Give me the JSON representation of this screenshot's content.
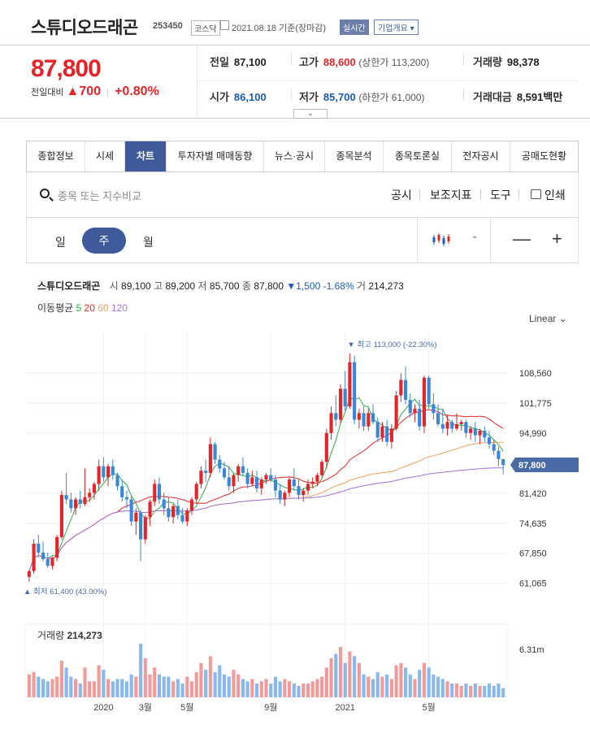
{
  "header": {
    "name": "스튜디오드래곤",
    "code": "253450",
    "market": "코스닥",
    "date": "2021.08.18 기준(장마감)",
    "realtime": "실시간",
    "company": "기업개요 ▾"
  },
  "quote": {
    "price": "87,800",
    "change_label": "전일대비",
    "change_arrow": "▲",
    "change_value": "700",
    "change_pct": "+0.80%",
    "prev_label": "전일",
    "prev": "87,100",
    "high_label": "고가",
    "high": "88,600",
    "upper": "(상한가 113,200)",
    "vol_label": "거래량",
    "vol": "98,378",
    "open_label": "시가",
    "open": "86,100",
    "low_label": "저가",
    "low": "85,700",
    "lower": "(하한가 61,000)",
    "amt_label": "거래대금",
    "amt": "8,591",
    "amt_unit": "백만",
    "toggle": "⌄"
  },
  "tabs": [
    "종합정보",
    "시세",
    "차트",
    "투자자별 매매동향",
    "뉴스·공시",
    "종목분석",
    "종목토론실",
    "전자공시",
    "공매도현황"
  ],
  "toolbar": {
    "search_placeholder": "종목 또는 지수비교",
    "disclosure": "공시",
    "indicators": "보조지표",
    "tools": "도구",
    "print": "인쇄"
  },
  "periods": {
    "day": "일",
    "week": "주",
    "month": "월"
  },
  "zoom": {
    "out": "—",
    "in": "+"
  },
  "chart_info": {
    "name": "스튜디오드래곤",
    "o_lab": "시",
    "o": "89,100",
    "h_lab": "고",
    "h": "89,200",
    "l_lab": "저",
    "l": "85,700",
    "c_lab": "종",
    "c": "87,800",
    "chg": "▼1,500 -1.68%",
    "v_lab": "거",
    "v": "214,273",
    "ma_label": "이동평균",
    "ma": [
      "5",
      "20",
      "60",
      "120"
    ],
    "scale": "Linear ⌄",
    "vol_label": "거래량",
    "vol": "214,273",
    "vol_axis": "6.31m"
  },
  "chart_data": {
    "type": "candlestick",
    "yticks": [
      108560,
      101775,
      94990,
      81420,
      74635,
      67850,
      61065
    ],
    "ylim": [
      58800,
      117000
    ],
    "current_price": 87800,
    "current_label": "87,800",
    "max_label": "▼ 최고 113,000 (-22.30%)",
    "min_label": "▲ 최저 61,400 (43.00%)",
    "max_index": 69,
    "min_index": 0,
    "x_labels": [
      {
        "label": "2020",
        "i": 16
      },
      {
        "label": "3월",
        "i": 25
      },
      {
        "label": "5월",
        "i": 34
      },
      {
        "label": "9월",
        "i": 52
      },
      {
        "label": "2021",
        "i": 68
      },
      {
        "label": "5월",
        "i": 86
      }
    ],
    "ma_colors": [
      "#2eaa4a",
      "#e0262a",
      "#f0a058",
      "#a470e0"
    ],
    "candles": [
      [
        62500,
        64000,
        61400,
        63800,
        1.0
      ],
      [
        63800,
        71000,
        63200,
        70000,
        1.1
      ],
      [
        70000,
        72000,
        67000,
        68000,
        0.9
      ],
      [
        68000,
        70500,
        66000,
        66500,
        0.8
      ],
      [
        66500,
        68000,
        64500,
        65000,
        0.7
      ],
      [
        65000,
        67000,
        64200,
        66800,
        0.8
      ],
      [
        66800,
        72000,
        66000,
        71500,
        0.9
      ],
      [
        71500,
        82000,
        71000,
        81000,
        1.6
      ],
      [
        81000,
        86000,
        79000,
        80000,
        1.3
      ],
      [
        80000,
        81500,
        77000,
        78000,
        0.9
      ],
      [
        78000,
        80500,
        76500,
        80000,
        0.8
      ],
      [
        80000,
        82000,
        78000,
        79000,
        0.6
      ],
      [
        79000,
        87000,
        78500,
        80500,
        1.3
      ],
      [
        80500,
        82500,
        79500,
        81500,
        0.7
      ],
      [
        81500,
        84000,
        80000,
        83500,
        0.7
      ],
      [
        83500,
        89000,
        82000,
        87500,
        1.4
      ],
      [
        87500,
        89500,
        84000,
        85000,
        1.2
      ],
      [
        85000,
        88000,
        83000,
        87500,
        0.8
      ],
      [
        87500,
        89000,
        84500,
        85500,
        0.7
      ],
      [
        85500,
        86000,
        82000,
        83000,
        0.8
      ],
      [
        83000,
        84500,
        79500,
        80500,
        0.8
      ],
      [
        80500,
        82000,
        78000,
        80000,
        0.7
      ],
      [
        80000,
        81000,
        74000,
        75000,
        1.0
      ],
      [
        75000,
        78000,
        72000,
        77000,
        0.9
      ],
      [
        77000,
        77500,
        66000,
        71000,
        1.3
      ],
      [
        71000,
        76500,
        70000,
        76000,
        1.7
      ],
      [
        76000,
        80000,
        74000,
        79500,
        1.0
      ],
      [
        79500,
        84500,
        78500,
        83500,
        1.3
      ],
      [
        83500,
        85000,
        79000,
        80000,
        1.0
      ],
      [
        80000,
        81500,
        76500,
        78000,
        0.9
      ],
      [
        78000,
        80500,
        75000,
        76000,
        0.9
      ],
      [
        76000,
        79000,
        74500,
        78500,
        0.7
      ],
      [
        78500,
        80000,
        75500,
        76500,
        0.8
      ],
      [
        76500,
        78000,
        74500,
        75000,
        0.6
      ],
      [
        75000,
        78000,
        74000,
        77500,
        0.9
      ],
      [
        77500,
        80500,
        76500,
        80000,
        0.7
      ],
      [
        80000,
        84000,
        79000,
        83500,
        1.1
      ],
      [
        83500,
        87500,
        82500,
        86500,
        1.5
      ],
      [
        86500,
        89000,
        84000,
        86000,
        1.2
      ],
      [
        86000,
        94000,
        85000,
        92500,
        1.8
      ],
      [
        92500,
        93000,
        88000,
        89000,
        1.1
      ],
      [
        89000,
        90000,
        86000,
        87000,
        1.4
      ],
      [
        87000,
        88500,
        84500,
        85000,
        1.0
      ],
      [
        85000,
        87500,
        82000,
        83000,
        0.9
      ],
      [
        83000,
        86000,
        81500,
        85500,
        1.2
      ],
      [
        85500,
        88000,
        84000,
        87500,
        1.0
      ],
      [
        87500,
        89500,
        85500,
        86000,
        0.8
      ],
      [
        86000,
        87000,
        82500,
        83500,
        0.7
      ],
      [
        83500,
        86500,
        83000,
        85000,
        0.8
      ],
      [
        85000,
        86500,
        81500,
        82500,
        0.6
      ],
      [
        82500,
        85000,
        81000,
        84500,
        0.7
      ],
      [
        84500,
        86000,
        83500,
        85500,
        0.8
      ],
      [
        85500,
        87000,
        84000,
        84500,
        0.6
      ],
      [
        84500,
        85500,
        80500,
        82000,
        0.9
      ],
      [
        82000,
        83500,
        79000,
        80000,
        0.7
      ],
      [
        80000,
        82000,
        78500,
        81500,
        0.8
      ],
      [
        81500,
        85000,
        80500,
        84500,
        0.7
      ],
      [
        84500,
        87000,
        82000,
        83000,
        0.6
      ],
      [
        83000,
        84500,
        80000,
        81000,
        0.5
      ],
      [
        81000,
        82500,
        79500,
        82000,
        0.6
      ],
      [
        82000,
        84500,
        81000,
        83500,
        0.6
      ],
      [
        83500,
        85000,
        82500,
        84000,
        0.7
      ],
      [
        84000,
        86000,
        83000,
        85500,
        0.8
      ],
      [
        85500,
        89000,
        85000,
        88500,
        0.9
      ],
      [
        88500,
        96000,
        87000,
        95000,
        1.3
      ],
      [
        95000,
        101000,
        93500,
        99500,
        1.7
      ],
      [
        99500,
        103500,
        96500,
        98000,
        1.9
      ],
      [
        98000,
        106000,
        97000,
        105000,
        2.2
      ],
      [
        105000,
        109000,
        100000,
        101000,
        1.5
      ],
      [
        101000,
        113000,
        100500,
        111000,
        2.0
      ],
      [
        111000,
        112500,
        97000,
        98000,
        1.8
      ],
      [
        98000,
        100500,
        96000,
        99500,
        1.5
      ],
      [
        99500,
        101000,
        95500,
        96500,
        1.0
      ],
      [
        96500,
        100500,
        95500,
        99500,
        0.9
      ],
      [
        99500,
        101500,
        97000,
        97500,
        0.8
      ],
      [
        97500,
        98500,
        93000,
        94000,
        1.1
      ],
      [
        94000,
        97500,
        93000,
        96500,
        0.9
      ],
      [
        96500,
        98000,
        92000,
        93000,
        1.0
      ],
      [
        93000,
        97000,
        91500,
        96000,
        0.8
      ],
      [
        96000,
        104500,
        95500,
        103500,
        1.4
      ],
      [
        103500,
        108500,
        102000,
        107000,
        1.5
      ],
      [
        107000,
        110000,
        101500,
        102500,
        1.3
      ],
      [
        102500,
        104000,
        98500,
        99500,
        1.0
      ],
      [
        99500,
        101500,
        97500,
        100500,
        0.8
      ],
      [
        100500,
        102500,
        95500,
        96500,
        1.2
      ],
      [
        96500,
        108000,
        95000,
        107500,
        1.5
      ],
      [
        107500,
        108000,
        100500,
        101500,
        1.3
      ],
      [
        101500,
        104000,
        98000,
        99500,
        1.0
      ],
      [
        99500,
        101500,
        96500,
        97000,
        0.9
      ],
      [
        97000,
        100500,
        95000,
        96000,
        0.8
      ],
      [
        96000,
        99000,
        94500,
        97500,
        0.7
      ],
      [
        97500,
        98000,
        95000,
        96000,
        0.6
      ],
      [
        96000,
        99500,
        95500,
        97000,
        0.6
      ],
      [
        97000,
        98000,
        95500,
        97500,
        0.5
      ],
      [
        97500,
        98000,
        94000,
        95000,
        0.6
      ],
      [
        95000,
        96500,
        93500,
        96000,
        0.5
      ],
      [
        96000,
        97500,
        93000,
        94500,
        0.6
      ],
      [
        94500,
        96000,
        92500,
        95500,
        0.5
      ],
      [
        95500,
        96500,
        93000,
        94000,
        0.5
      ],
      [
        94000,
        95500,
        91500,
        92500,
        0.6
      ],
      [
        92500,
        93500,
        90000,
        91000,
        0.5
      ],
      [
        91000,
        92000,
        87500,
        89100,
        0.6
      ],
      [
        89100,
        89200,
        85700,
        87800,
        0.4
      ]
    ]
  }
}
